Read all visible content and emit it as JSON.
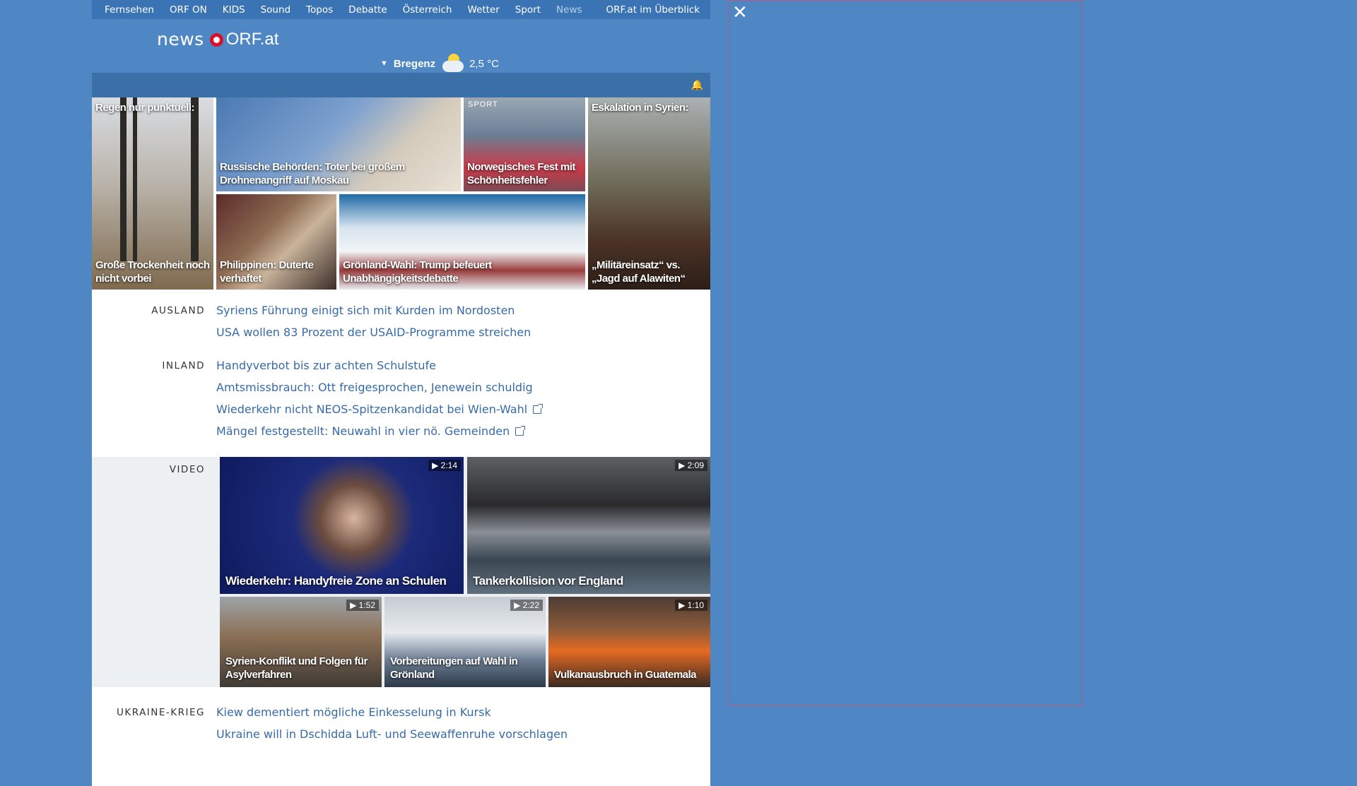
{
  "topnav": {
    "items": [
      "Fernsehen",
      "ORF ON",
      "KIDS",
      "Sound",
      "Topos",
      "Debatte",
      "Österreich",
      "Wetter",
      "Sport",
      "News"
    ],
    "overview": "ORF.at im Überblick"
  },
  "header": {
    "logo_news": "news",
    "logo_orf": "ORF.at",
    "weather_location": "Bregenz",
    "weather_temp": "2,5 °C"
  },
  "teasers": [
    {
      "top": "Regen nur punktuell:",
      "caption": "Große Trockenheit noch nicht vorbei"
    },
    {
      "caption": "Russische Behörden: Toter bei großem Drohnenangriff auf Moskau"
    },
    {
      "tag": "SPORT",
      "caption": "Norwegisches Fest mit Schönheitsfehler"
    },
    {
      "top": "Eskalation in Syrien:",
      "caption": "„Militäreinsatz“ vs. „Jagd auf Alawiten“"
    },
    {
      "caption": "Philippinen: Duterte verhaftet"
    },
    {
      "caption": "Grönland-Wahl: Trump befeuert Unabhängigkeitsdebatte"
    }
  ],
  "ausland": {
    "label": "AUSLAND",
    "links": [
      "Syriens Führung einigt sich mit Kurden im Nordosten",
      "USA wollen 83 Prozent der USAID-Programme streichen"
    ]
  },
  "inland": {
    "label": "INLAND",
    "links": [
      "Handyverbot bis zur achten Schulstufe",
      "Amtsmissbrauch: Ott freigesprochen, Jenewein schuldig",
      "Wiederkehr nicht NEOS-Spitzenkandidat bei Wien-Wahl",
      "Mängel festgestellt: Neuwahl in vier nö. Gemeinden"
    ]
  },
  "video": {
    "label": "VIDEO",
    "items": [
      {
        "duration": "▶ 2:14",
        "caption": "Wiederkehr: Handyfreie Zone an Schulen"
      },
      {
        "duration": "▶ 2:09",
        "caption": "Tankerkollision vor England"
      },
      {
        "duration": "▶ 1:52",
        "caption": "Syrien-Konflikt und Folgen für Asylverfahren"
      },
      {
        "duration": "▶ 2:22",
        "caption": "Vorbereitungen auf Wahl in Grönland"
      },
      {
        "duration": "▶ 1:10",
        "caption": "Vulkanausbruch in Guatemala"
      }
    ]
  },
  "ukraine": {
    "label": "UKRAINE-KRIEG",
    "links": [
      "Kiew dementiert mögliche Einkesselung in Kursk",
      "Ukraine will in Dschidda Luft- und Seewaffenruhe vorschlagen"
    ]
  },
  "colors": {
    "background": "#4f86c4",
    "link": "#376ba8",
    "logo_red": "#d8112b"
  }
}
